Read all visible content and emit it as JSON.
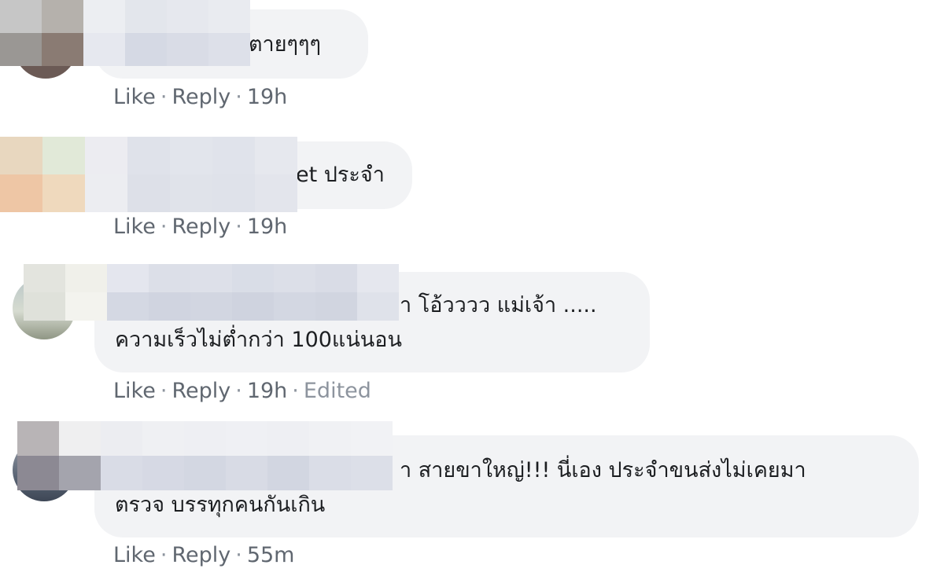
{
  "comments": [
    {
      "text_line1": "ตายๆๆๆ",
      "text_line2": "",
      "like": "Like",
      "reply": "Reply",
      "time": "19h",
      "edited": ""
    },
    {
      "text_line1": "et ประจำ",
      "text_line2": "",
      "like": "Like",
      "reply": "Reply",
      "time": "19h",
      "edited": ""
    },
    {
      "text_line1": "า โอ้วววว แม่เจ้า .....",
      "text_line2": "ความเร็วไม่ต่ำกว่า 100แน่นอน",
      "like": "Like",
      "reply": "Reply",
      "time": "19h",
      "edited": "Edited"
    },
    {
      "text_line1": "า สายขาใหญ่!!! นี่เอง ประจำขนส่งไม่เคยมา",
      "text_line2": "ตรวจ บรรทุกคนกันเกิน",
      "like": "Like",
      "reply": "Reply",
      "time": "55m",
      "edited": ""
    }
  ],
  "separator": "·"
}
